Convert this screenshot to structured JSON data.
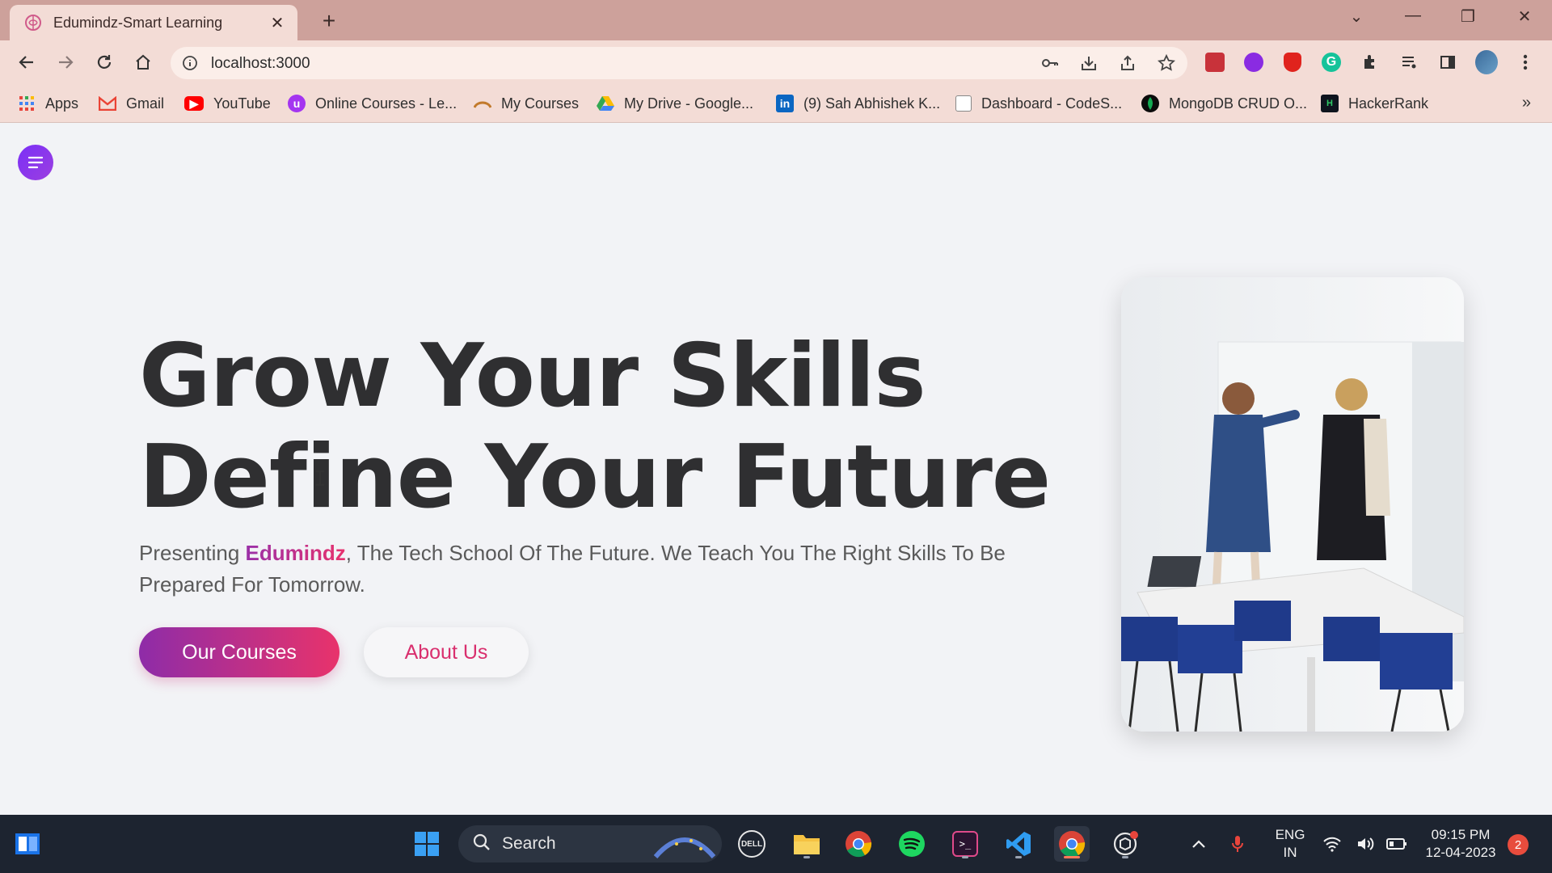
{
  "browser": {
    "tab_title": "Edumindz-Smart Learning",
    "url": "localhost:3000",
    "bookmarks": [
      {
        "label": "Apps",
        "icon": "apps-grid-icon"
      },
      {
        "label": "Gmail",
        "icon": "gmail-icon"
      },
      {
        "label": "YouTube",
        "icon": "youtube-icon"
      },
      {
        "label": "Online Courses - Le...",
        "icon": "udemy-icon"
      },
      {
        "label": "My Courses",
        "icon": "courses-icon"
      },
      {
        "label": "My Drive - Google...",
        "icon": "google-drive-icon"
      },
      {
        "label": "(9) Sah Abhishek K...",
        "icon": "linkedin-icon"
      },
      {
        "label": "Dashboard - CodeS...",
        "icon": "page-icon"
      },
      {
        "label": "MongoDB CRUD O...",
        "icon": "mongodb-icon"
      },
      {
        "label": "HackerRank",
        "icon": "hackerrank-icon"
      }
    ]
  },
  "hero": {
    "title_line1": "Grow Your Skills",
    "title_line2": "Define Your Future",
    "desc_before": "Presenting ",
    "brand_name": "Edumindz",
    "desc_after": ", The Tech School Of The Future. We Teach You The Right Skills To Be Prepared For Tomorrow.",
    "primary_button": "Our Courses",
    "secondary_button": "About Us"
  },
  "taskbar": {
    "search_label": "Search",
    "lang_line1": "ENG",
    "lang_line2": "IN",
    "time": "09:15 PM",
    "date": "12-04-2023",
    "notification_count": "2"
  },
  "colors": {
    "brand_gradient_start": "#8e2ca8",
    "brand_gradient_end": "#e8336b",
    "tab_strip": "#cda19b",
    "toolbar": "#f3dcd6",
    "taskbar": "#1d2430"
  }
}
